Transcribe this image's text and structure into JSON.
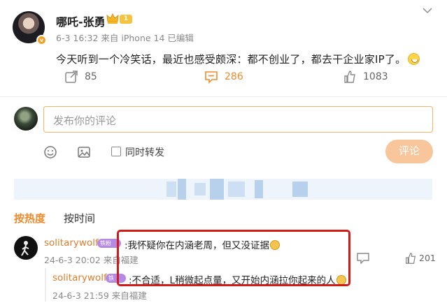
{
  "post": {
    "author": "哪吒-张勇",
    "verified_badge": "v",
    "level": "1",
    "meta": "6-3 16:32 来自 iPhone 14 已编辑",
    "content": "今天听到一个冷笑话，最近也感受颇深：都不创业了，都去干企业家IP了。",
    "actions": {
      "share_count": "85",
      "comment_count": "286",
      "like_count": "1083"
    }
  },
  "composer": {
    "placeholder": "发布你的评论",
    "repost_label": "同时转发",
    "submit_label": "评论"
  },
  "sort": {
    "hot": "按热度",
    "time": "按时间"
  },
  "comments": [
    {
      "user": "solitarywolf",
      "tag": "铁粉",
      "text": ":我怀疑你在内涵老周，但又没证据",
      "meta": "24-6-3 20:02 来自福建",
      "like_count": "201",
      "replies": [
        {
          "user": "solitarywolf",
          "tag": "铁",
          "text": ":不合适，L稍微起点量，又开始内涵拉你起来的人",
          "meta": "24-6-3 21:59 来自福建"
        }
      ]
    }
  ],
  "colors": {
    "accent": "#f08a2c",
    "username": "#e07d2b",
    "submit_bg": "#f9c59a",
    "highlight": "#d11a1a"
  }
}
